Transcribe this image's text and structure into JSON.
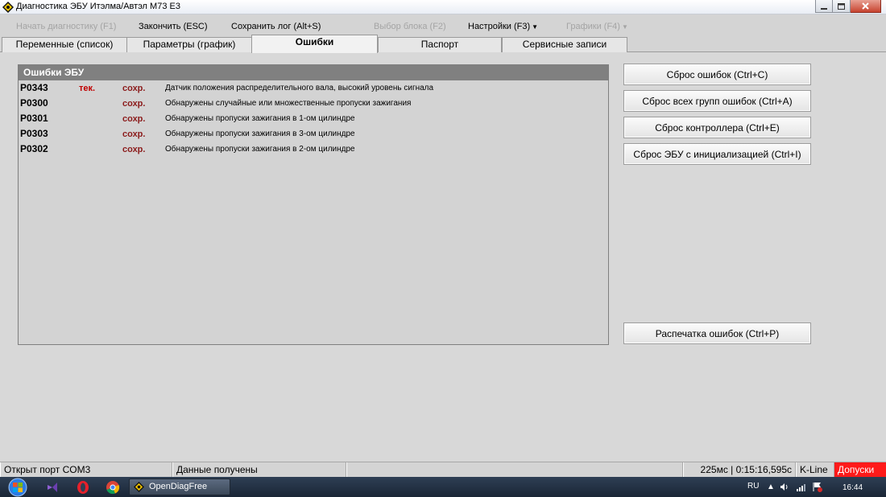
{
  "window": {
    "title": "Диагностика ЭБУ Итэлма/Автэл M73 E3",
    "icon": "app-logo-icon"
  },
  "menu": {
    "start_diag": "Начать диагностику (F1)",
    "finish": "Закончить (ESC)",
    "save_log": "Сохранить лог (Alt+S)",
    "select_block": "Выбор блока (F2)",
    "settings": "Настройки (F3)",
    "graphs": "Графики (F4)"
  },
  "tabs": [
    {
      "label": "Переменные (список)"
    },
    {
      "label": "Параметры (график)"
    },
    {
      "label": "Ошибки"
    },
    {
      "label": "Паспорт"
    },
    {
      "label": "Сервисные записи"
    }
  ],
  "errors_panel": {
    "header": "Ошибки ЭБУ",
    "rows": [
      {
        "code": "P0343",
        "current": "тек.",
        "saved": "сохр.",
        "description": "Датчик положения распределительного вала, высокий уровень сигнала"
      },
      {
        "code": "P0300",
        "current": "",
        "saved": "сохр.",
        "description": "Обнаружены случайные или множественные пропуски зажигания"
      },
      {
        "code": "P0301",
        "current": "",
        "saved": "сохр.",
        "description": "Обнаружены пропуски зажигания в 1-ом цилиндре"
      },
      {
        "code": "P0303",
        "current": "",
        "saved": "сохр.",
        "description": "Обнаружены пропуски зажигания в 3-ом цилиндре"
      },
      {
        "code": "P0302",
        "current": "",
        "saved": "сохр.",
        "description": "Обнаружены пропуски зажигания в 2-ом цилиндре"
      }
    ]
  },
  "actions": {
    "reset_errors": "Сброс ошибок (Ctrl+C)",
    "reset_all_groups": "Сброс всех групп ошибок (Ctrl+A)",
    "reset_controller": "Сброс контроллера (Ctrl+E)",
    "reset_ecu_init": "Сброс ЭБУ с инициализацией (Ctrl+I)",
    "print_errors": "Распечатка ошибок (Ctrl+P)"
  },
  "status": {
    "port": "Открыт порт COM3",
    "data": "Данные получены",
    "timing": "225мс | 0:15:16,595с",
    "protocol": "K-Line",
    "tolerances": "Допуски"
  },
  "taskbar": {
    "app_label": "OpenDiagFree",
    "lang": "RU",
    "clock": "16:44"
  },
  "colors": {
    "error_current": "#c00000",
    "error_saved": "#8b1a1a",
    "panel_header": "#808080",
    "status_alert": "#ff1a1a"
  }
}
